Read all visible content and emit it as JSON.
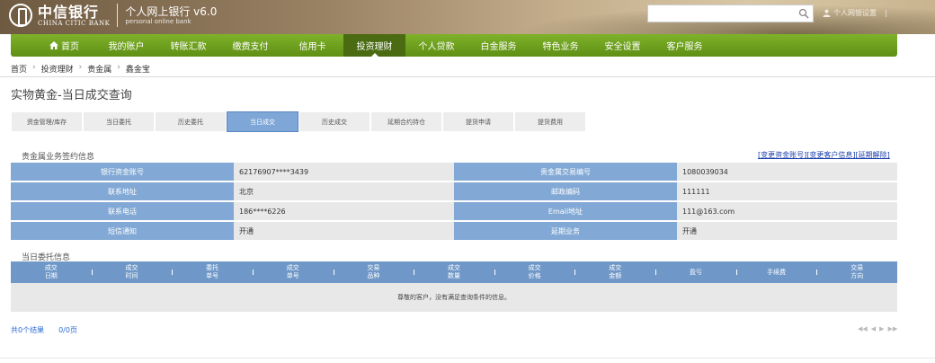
{
  "header": {
    "logo_cn": "中信银行",
    "logo_en": "CHINA CITIC BANK",
    "site_title": "个人网上银行 v6.0",
    "site_subtitle": "personal online bank",
    "search_value": "",
    "user_text": "个人网银设置",
    "separator": "|"
  },
  "nav": {
    "items": [
      {
        "label": "首页"
      },
      {
        "label": "我的账户"
      },
      {
        "label": "转账汇款"
      },
      {
        "label": "缴费支付"
      },
      {
        "label": "信用卡"
      },
      {
        "label": "投资理财"
      },
      {
        "label": "个人贷款"
      },
      {
        "label": "白金服务"
      },
      {
        "label": "特色业务"
      },
      {
        "label": "安全设置"
      },
      {
        "label": "客户服务"
      }
    ],
    "active_index": 5
  },
  "breadcrumb": [
    "首页",
    "投资理财",
    "贵金属",
    "鑫金宝"
  ],
  "breadcrumb_sep": "›",
  "page_title": "实物黄金-当日成交查询",
  "subtabs": {
    "items": [
      "资金管理/库存",
      "当日委托",
      "历史委托",
      "当日成交",
      "历史成交",
      "延期合约持仓",
      "提货申请",
      "提货费用"
    ],
    "active_index": 3
  },
  "signing": {
    "section_label": "贵金属业务签约信息",
    "links": [
      "[变更资金账号]",
      "[变更客户信息]",
      "[延期解除]"
    ],
    "rows": [
      {
        "l1": "银行资金账号",
        "v1": "62176907****3439",
        "l2": "贵金属交易编号",
        "v2": "1080039034"
      },
      {
        "l1": "联系地址",
        "v1": "北京",
        "l2": "邮政编码",
        "v2": "111111"
      },
      {
        "l1": "联系电话",
        "v1": "186****6226",
        "l2": "Email地址",
        "v2": "111@163.com"
      },
      {
        "l1": "短信通知",
        "v1": "开通",
        "l2": "延期业务",
        "v2": "开通"
      }
    ]
  },
  "orders": {
    "section_label": "当日委托信息",
    "columns": [
      [
        "成交",
        "日期"
      ],
      [
        "成交",
        "时间"
      ],
      [
        "委托",
        "单号"
      ],
      [
        "成交",
        "单号"
      ],
      [
        "交易",
        "品种"
      ],
      [
        "成交",
        "数量"
      ],
      [
        "成交",
        "价格"
      ],
      [
        "成交",
        "金额"
      ],
      [
        "盈亏",
        ""
      ],
      [
        "手续费",
        ""
      ],
      [
        "交易",
        "方向"
      ]
    ],
    "empty_text": "尊敬的客户，没有满足查询条件的信息。"
  },
  "pager": {
    "total": "共0个结果",
    "pages": "0/0页",
    "controls": [
      "◀◀",
      "◀",
      "▶",
      "▶▶"
    ]
  }
}
